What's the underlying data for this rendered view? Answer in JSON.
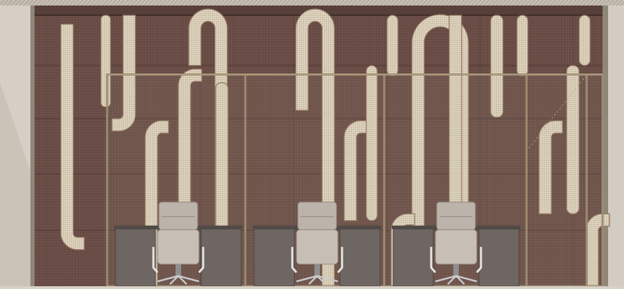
{
  "palette": {
    "wall_bg": "#6b4e47",
    "wall_dark": "#57403a",
    "stripe_fill": "#d9cdb8",
    "stripe_edge": "#8a6f5a",
    "glass_frame": "#9c8c70",
    "side_panel": "#d2ccc2",
    "top_trim": "#bfb8aa",
    "desk": "#6e6663",
    "desk_top": "#514b48",
    "chair": "#bcb3aa"
  },
  "objects": {
    "chairs_count": 3,
    "desks_count": 3,
    "glass_panels_count": 4
  }
}
